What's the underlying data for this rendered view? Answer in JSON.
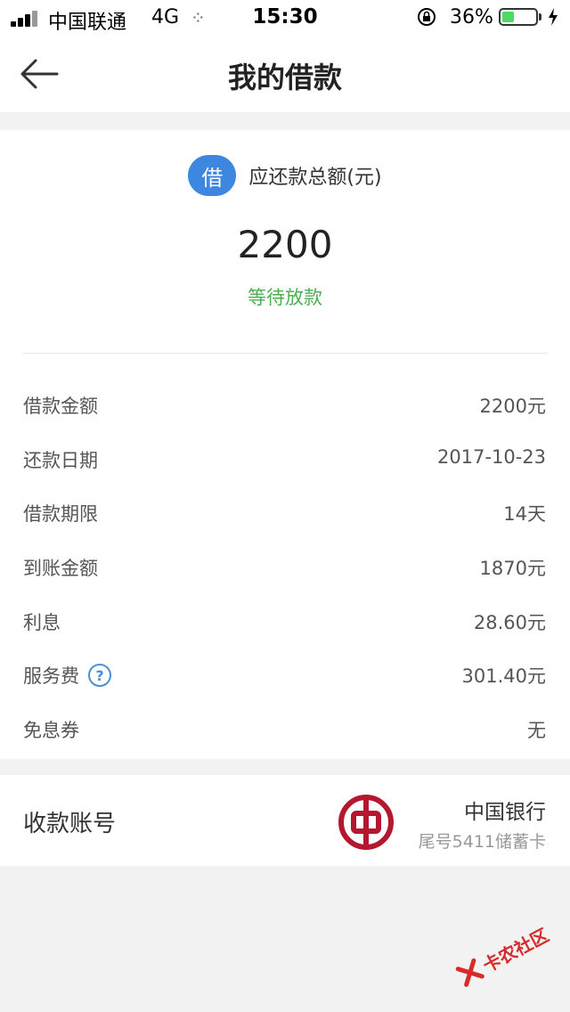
{
  "status_bar": {
    "carrier": "中国联通",
    "network": "4G",
    "time": "15:30",
    "battery_percent_text": "36%",
    "battery_level": 0.36,
    "colors": {
      "battery_fill": "#4cd964"
    }
  },
  "nav": {
    "title": "我的借款",
    "back_icon": "arrow-left-icon"
  },
  "summary": {
    "badge": "借",
    "total_label": "应还款总额(元)",
    "total_amount": "2200",
    "status": "等待放款",
    "colors": {
      "badge": "#3d87e0",
      "status": "#4caf50"
    }
  },
  "details": [
    {
      "label": "借款金额",
      "value": "2200元"
    },
    {
      "label": "还款日期",
      "value": "2017-10-23"
    },
    {
      "label": "借款期限",
      "value": "14天"
    },
    {
      "label": "到账金额",
      "value": "1870元"
    },
    {
      "label": "利息",
      "value": "28.60元"
    },
    {
      "label": "服务费",
      "value": "301.40元",
      "help_icon": "question-circle-icon"
    },
    {
      "label": "免息券",
      "value": "无"
    }
  ],
  "account": {
    "label": "收款账号",
    "bank_name": "中国银行",
    "card_tail": "尾号5411储蓄卡",
    "logo_icon": "bank-of-china-logo",
    "colors": {
      "logo": "#b5172f"
    }
  },
  "watermark": {
    "text": "卡农社区"
  }
}
